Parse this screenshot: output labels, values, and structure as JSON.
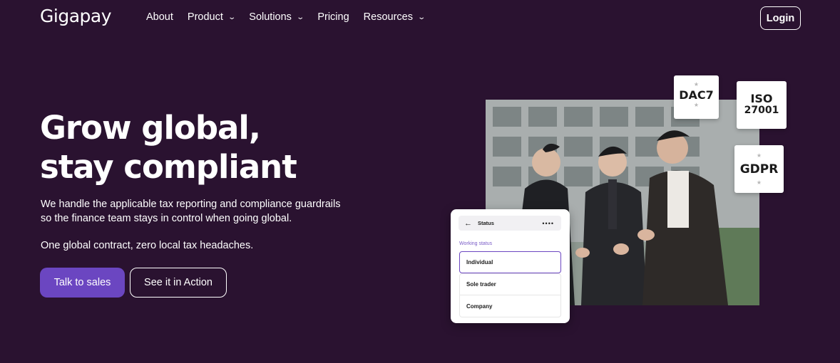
{
  "brand": {
    "logo_text": "Gigapay",
    "accent": "#6b46c1",
    "background": "#2a1230"
  },
  "nav": {
    "items": [
      {
        "label": "About",
        "has_dropdown": false
      },
      {
        "label": "Product",
        "has_dropdown": true
      },
      {
        "label": "Solutions",
        "has_dropdown": true
      },
      {
        "label": "Pricing",
        "has_dropdown": false
      },
      {
        "label": "Resources",
        "has_dropdown": true
      }
    ],
    "login_label": "Login"
  },
  "hero": {
    "title_line1": "Grow global,",
    "title_line2": "stay compliant",
    "description": "We handle the applicable tax reporting and compliance guardrails so the finance team stays in control when going global.",
    "tagline": "One global contract, zero local tax headaches.",
    "primary_cta": "Talk to sales",
    "secondary_cta": "See it in Action"
  },
  "badges": {
    "dac7": "DAC7",
    "iso_line1": "ISO",
    "iso_line2": "27001",
    "gdpr": "GDPR"
  },
  "status_card": {
    "title": "Status",
    "section_label": "Working status",
    "options": [
      "Individual",
      "Sole trader",
      "Company"
    ],
    "selected": "Individual"
  }
}
